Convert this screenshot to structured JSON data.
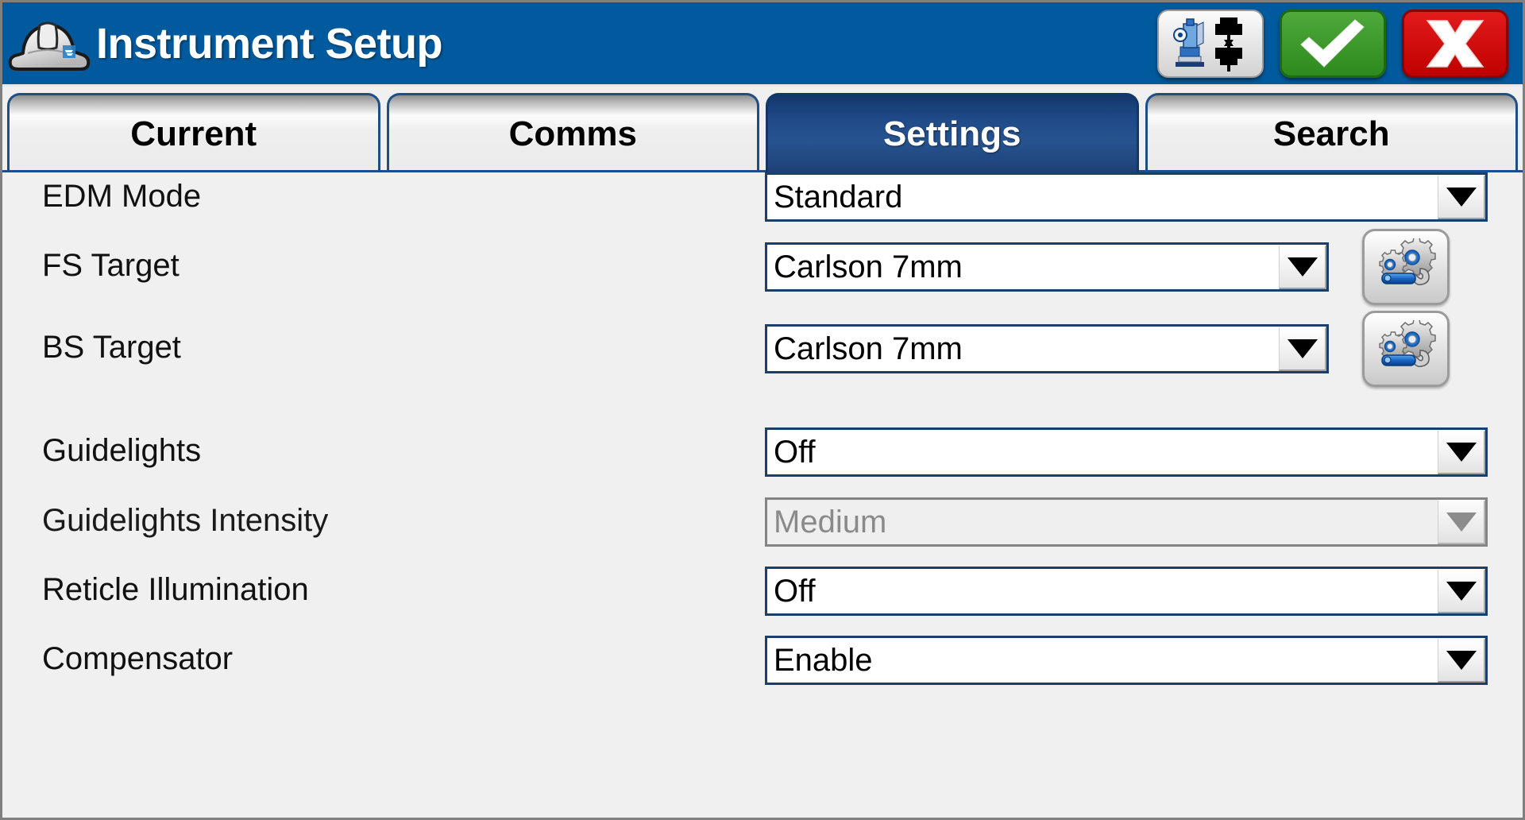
{
  "header": {
    "title": "Instrument Setup",
    "logo_icon": "hard-hat-icon",
    "buttons": [
      {
        "name": "instrument-transfer-button",
        "icon": "total-station-transfer-icon",
        "label": ""
      },
      {
        "name": "accept-button",
        "icon": "check-icon",
        "label": ""
      },
      {
        "name": "cancel-button",
        "icon": "x-icon",
        "label": "X"
      }
    ]
  },
  "tabs": [
    {
      "label": "Current",
      "active": false
    },
    {
      "label": "Comms",
      "active": false
    },
    {
      "label": "Settings",
      "active": true
    },
    {
      "label": "Search",
      "active": false
    }
  ],
  "settings": {
    "rows": [
      {
        "label": "EDM Mode",
        "value": "Standard",
        "disabled": false,
        "gear": false
      },
      {
        "label": "FS Target",
        "value": "Carlson 7mm",
        "disabled": false,
        "gear": true
      },
      {
        "label": "BS Target",
        "value": "Carlson 7mm",
        "disabled": false,
        "gear": true
      },
      {
        "label": "Guidelights",
        "value": "Off",
        "disabled": false,
        "gear": false
      },
      {
        "label": "Guidelights Intensity",
        "value": "Medium",
        "disabled": true,
        "gear": false
      },
      {
        "label": "Reticle Illumination",
        "value": "Off",
        "disabled": false,
        "gear": false
      },
      {
        "label": "Compensator",
        "value": "Enable",
        "disabled": false,
        "gear": false
      }
    ],
    "gear_icon": "gears-wrench-icon",
    "dropdown_icon": "chevron-down-icon"
  },
  "colors": {
    "header_blue": "#025a9e",
    "active_tab_blue": "#1f4a87",
    "tab_border": "#1d4f86",
    "field_border": "#1b3f6b",
    "page_bg": "#f0f0f0",
    "accept_green": "#2e8a1e",
    "cancel_red": "#c00000",
    "disabled_gray": "#8a8a8a"
  }
}
